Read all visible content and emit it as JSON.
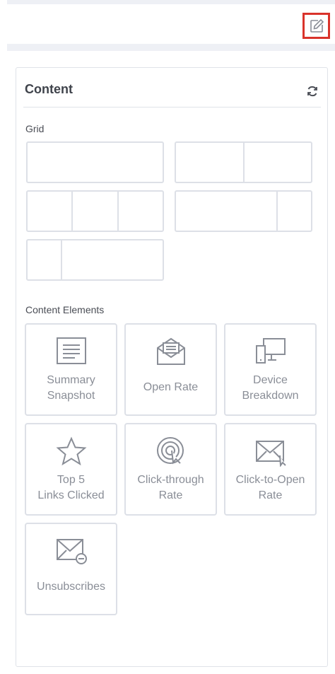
{
  "panel": {
    "title": "Content",
    "grid_label": "Grid",
    "elements_label": "Content Elements"
  },
  "grid_layouts": [
    {
      "columns": [
        1
      ]
    },
    {
      "columns": [
        1,
        1
      ]
    },
    {
      "columns": [
        1,
        1,
        1
      ]
    },
    {
      "columns": [
        3,
        1
      ]
    },
    {
      "columns": [
        1,
        3
      ]
    }
  ],
  "content_elements": [
    {
      "label": "Summary\nSnapshot",
      "icon": "summary-icon"
    },
    {
      "label": "Open Rate",
      "icon": "open-envelope-icon"
    },
    {
      "label": "Device\nBreakdown",
      "icon": "devices-icon"
    },
    {
      "label": "Top 5\nLinks Clicked",
      "icon": "star-icon"
    },
    {
      "label": "Click-through\nRate",
      "icon": "target-icon"
    },
    {
      "label": "Click-to-Open\nRate",
      "icon": "envelope-cursor-icon"
    },
    {
      "label": "Unsubscribes",
      "icon": "envelope-minus-icon"
    }
  ],
  "colors": {
    "highlight": "#d9332b",
    "border": "#dde0e7",
    "icon": "#8a8e97"
  }
}
